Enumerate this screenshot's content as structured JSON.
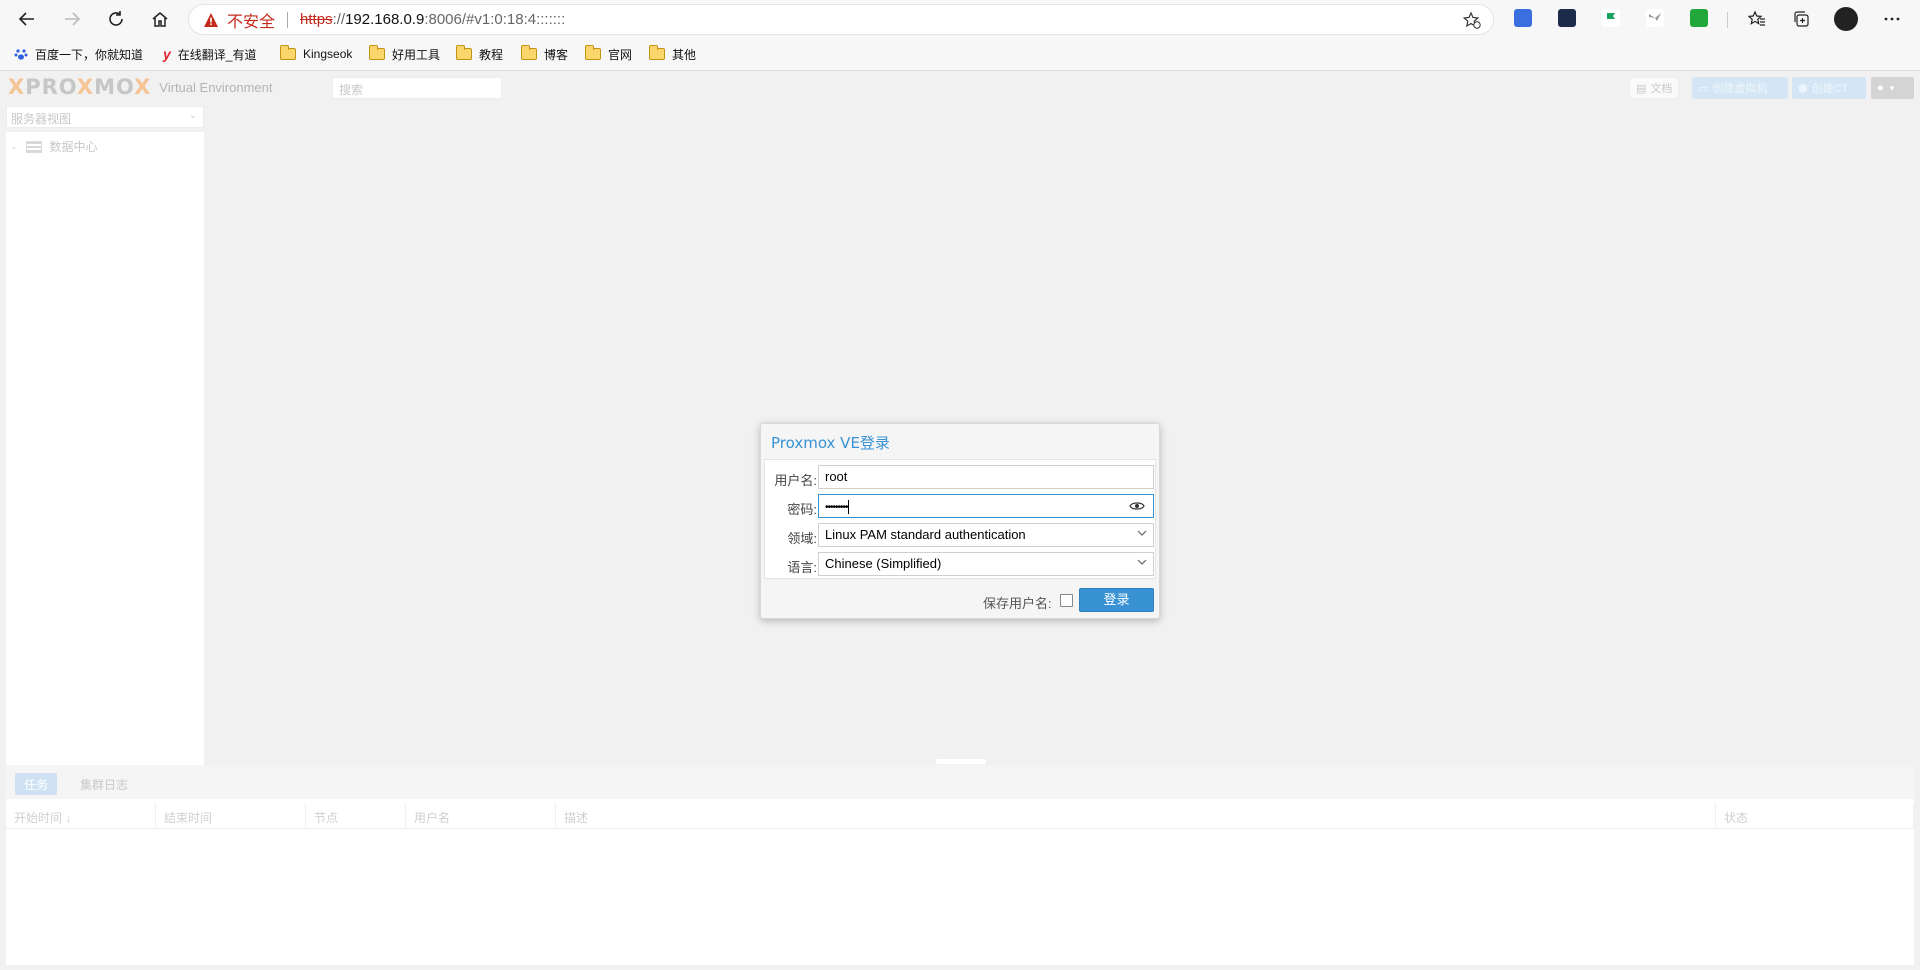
{
  "browser": {
    "security_label": "不安全",
    "url": {
      "scheme": "https",
      "separator": "://",
      "host": "192.168.0.9",
      "rest": ":8006/#v1:0:18:4:::::::"
    },
    "bookmarks": [
      {
        "label": "百度一下，你就知道",
        "icon": "baidu-paw-icon"
      },
      {
        "label": "在线翻译_有道",
        "icon": "youdao-icon"
      },
      {
        "label": "Kingseok",
        "icon": "folder-icon"
      },
      {
        "label": "好用工具",
        "icon": "folder-icon"
      },
      {
        "label": "教程",
        "icon": "folder-icon"
      },
      {
        "label": "博客",
        "icon": "folder-icon"
      },
      {
        "label": "官网",
        "icon": "folder-icon"
      },
      {
        "label": "其他",
        "icon": "folder-icon"
      }
    ]
  },
  "pve": {
    "logo_text": "PROXMOX",
    "product": "Virtual Environment",
    "search_placeholder": "搜索",
    "toolbar": {
      "docs": "文档",
      "create_vm": "创建虚拟机",
      "create_ct": "创建CT"
    },
    "view_selector": "服务器视图",
    "tree_root": "数据中心",
    "bottom_tabs": [
      "任务",
      "集群日志"
    ],
    "columns": [
      "开始时间 ↓",
      "结束时间",
      "节点",
      "用户名",
      "描述",
      "状态"
    ]
  },
  "login": {
    "title": "Proxmox VE登录",
    "username_label": "用户名:",
    "username_value": "root",
    "password_label": "密码:",
    "password_mask": "•••••••••",
    "realm_label": "领域:",
    "realm_value": "Linux PAM standard authentication",
    "language_label": "语言:",
    "language_value": "Chinese (Simplified)",
    "save_username_label": "保存用户名:",
    "save_username_checked": false,
    "login_button": "登录"
  },
  "colors": {
    "accent": "#3892d4",
    "insecure": "#c42b1c"
  }
}
